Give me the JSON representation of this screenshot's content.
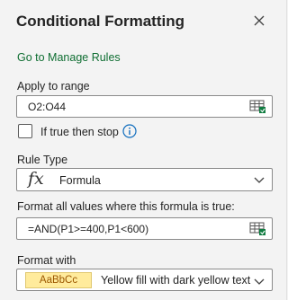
{
  "pane": {
    "title": "Conditional Formatting",
    "manage_rules_link": "Go to Manage Rules"
  },
  "apply_to_range": {
    "label": "Apply to range",
    "value": "O2:O44"
  },
  "stop_if_true": {
    "label": "If true then stop",
    "checked": false
  },
  "rule_type": {
    "label": "Rule Type",
    "icon_glyph": "fx",
    "value": "Formula"
  },
  "formula": {
    "label": "Format all values where this formula is true:",
    "value": "=AND(P1>=400,P1<600)"
  },
  "format_with": {
    "label": "Format with",
    "preview_text": "AaBbCc",
    "value": "Yellow fill with dark yellow text",
    "preview_fill": "#ffeb9c",
    "preview_text_color": "#9c5700"
  },
  "colors": {
    "link": "#0f6e32",
    "info_icon": "#0f6cbd",
    "range_icon_green": "#107c41"
  }
}
